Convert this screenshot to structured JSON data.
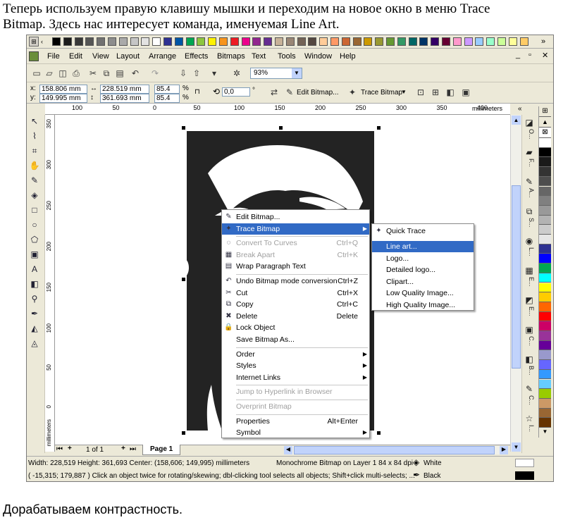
{
  "doc": {
    "line1": "Теперь используем правую клавишу мышки и переходим на новое окно в меню Trace",
    "line2": "Bitmap. Здесь нас интересует команда, именуемая Line Art.",
    "footer": "Дорабатываем контрастность."
  },
  "window": {
    "close_glyph": "✕",
    "restore_glyph": "▫",
    "min_glyph": "_",
    "top_right_glyph": "»"
  },
  "menubar": [
    "File",
    "Edit",
    "View",
    "Layout",
    "Arrange",
    "Effects",
    "Bitmaps",
    "Text",
    "Tools",
    "Window",
    "Help"
  ],
  "toolbar": {
    "zoom": "93%"
  },
  "propbar": {
    "x_label": "x:",
    "x": "158.806 mm",
    "y_label": "y:",
    "y": "149.995 mm",
    "w": "228.519 mm",
    "h": "361.693 mm",
    "sx": "85.4",
    "sy": "85.4",
    "pct1": "%",
    "pct2": "%",
    "angle": "0,0",
    "deg": "°",
    "edit_bitmap": "Edit Bitmap...",
    "trace_bitmap": "Trace Bitmap"
  },
  "ruler": {
    "h_ticks": [
      "100",
      "50",
      "0",
      "50",
      "100",
      "150",
      "200",
      "250",
      "300",
      "350",
      "400"
    ],
    "units": "millimeters",
    "v_ticks": [
      "350",
      "300",
      "250",
      "200",
      "150",
      "100",
      "50",
      "0"
    ],
    "v_units": "millimeters"
  },
  "context_menu": {
    "items": [
      {
        "label": "Edit Bitmap...",
        "key": "",
        "state": "normal"
      },
      {
        "label": "Trace Bitmap",
        "key": "",
        "state": "highlight",
        "sub": true
      },
      {
        "label": "Convert To Curves",
        "key": "Ctrl+Q",
        "state": "disabled"
      },
      {
        "label": "Break Apart",
        "key": "Ctrl+K",
        "state": "disabled"
      },
      {
        "label": "Wrap Paragraph Text",
        "key": "",
        "state": "normal"
      },
      {
        "label": "Undo Bitmap mode conversion",
        "key": "Ctrl+Z",
        "state": "normal"
      },
      {
        "label": "Cut",
        "key": "Ctrl+X",
        "state": "normal"
      },
      {
        "label": "Copy",
        "key": "Ctrl+C",
        "state": "normal"
      },
      {
        "label": "Delete",
        "key": "Delete",
        "state": "normal"
      },
      {
        "label": "Lock Object",
        "key": "",
        "state": "normal"
      },
      {
        "label": "Save Bitmap As...",
        "key": "",
        "state": "normal"
      },
      {
        "label": "Order",
        "key": "",
        "state": "normal",
        "sub": true
      },
      {
        "label": "Styles",
        "key": "",
        "state": "normal",
        "sub": true
      },
      {
        "label": "Internet Links",
        "key": "",
        "state": "normal",
        "sub": true
      },
      {
        "label": "Jump to Hyperlink in Browser",
        "key": "",
        "state": "disabled"
      },
      {
        "label": "Overprint Bitmap",
        "key": "",
        "state": "disabled"
      },
      {
        "label": "Properties",
        "key": "Alt+Enter",
        "state": "normal"
      },
      {
        "label": "Symbol",
        "key": "",
        "state": "normal",
        "sub": true
      }
    ]
  },
  "submenu": {
    "items": [
      "Quick Trace",
      "Line art...",
      "Logo...",
      "Detailed logo...",
      "Clipart...",
      "Low Quality Image...",
      "High Quality Image..."
    ]
  },
  "docker_tabs": [
    "O...",
    "F...",
    "A...",
    "S...",
    "L...",
    "E...",
    "E...",
    "C...",
    "B...",
    "C...",
    "I..."
  ],
  "page_nav": {
    "page_of": "1 of 1",
    "page_tab": "Page 1"
  },
  "status": {
    "line1": "Width: 228,519  Height: 361,693  Center: (158,606; 149,995)  millimeters",
    "object": "Monochrome Bitmap on Layer 1 84 x 84 dpi",
    "fill": "White",
    "line2": "( -15,315; 179,887 )    Click an object twice for rotating/skewing; dbl-clicking tool selects all objects; Shift+click multi-selects; ...",
    "outline": "Black"
  },
  "colors": {
    "highlight": "#316ac5",
    "chrome": "#ece9d8",
    "palette": [
      "#ffffff",
      "#000000",
      "#1a1a1a",
      "#333333",
      "#4d4d4d",
      "#666666",
      "#808080",
      "#999999",
      "#b3b3b3",
      "#cccccc",
      "#e6e6e6",
      "#2e3192",
      "#0000ff",
      "#00a651",
      "#00ffff",
      "#ffff00",
      "#ffcc00",
      "#ff6600",
      "#ff0000",
      "#cc0066",
      "#993399",
      "#660099",
      "#9999cc",
      "#6666ff",
      "#3399ff",
      "#66ccff",
      "#99cc00",
      "#cc9966",
      "#996633",
      "#663300"
    ],
    "top_swatches": [
      "#000000",
      "#1c1c1c",
      "#383838",
      "#555555",
      "#717171",
      "#8d8d8d",
      "#aaaaaa",
      "#c6c6c6",
      "#e2e2e2",
      "#ffffff",
      "#2e3192",
      "#0055a5",
      "#00a651",
      "#8dc63f",
      "#fff200",
      "#f7941d",
      "#ed1c24",
      "#ec008c",
      "#92278f",
      "#662d91",
      "#c7b299",
      "#998675",
      "#736357",
      "#534741",
      "#ffcc99",
      "#ff9966",
      "#cc6633",
      "#996633",
      "#cc9900",
      "#999933",
      "#669933",
      "#339966",
      "#006666",
      "#003366",
      "#330066",
      "#660033",
      "#ff99cc",
      "#cc99ff",
      "#99ccff",
      "#99ffcc",
      "#ccff99",
      "#ffff99",
      "#ffcc66"
    ]
  }
}
